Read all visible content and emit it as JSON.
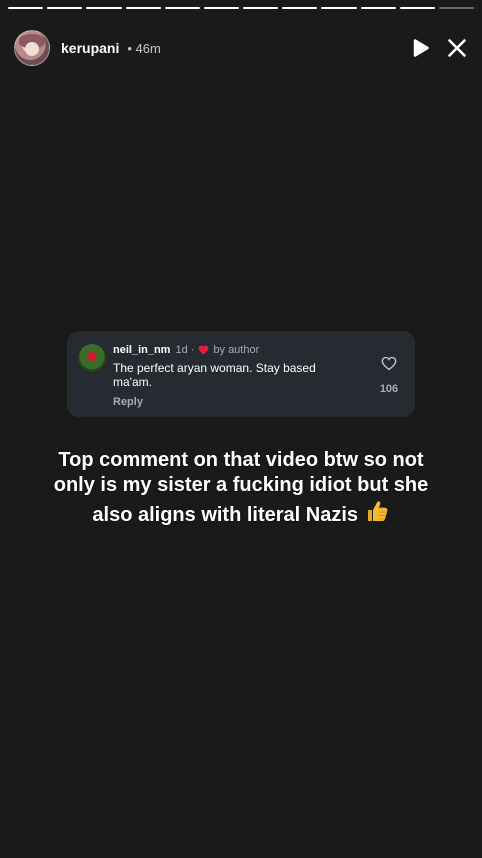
{
  "progress": {
    "segments": [
      1,
      1,
      1,
      1,
      1,
      1,
      1,
      1,
      1,
      1,
      1,
      0
    ]
  },
  "header": {
    "username": "kerupani",
    "time": "• 46m",
    "icons": [
      "play-icon",
      "close-icon"
    ]
  },
  "comment": {
    "username": "neil_in_nm",
    "age": "1d",
    "dot": "·",
    "author_label": "by author",
    "text": "The perfect aryan woman. Stay based ma'am.",
    "reply_label": "Reply",
    "like_count": "106",
    "icons": [
      "heart-icon",
      "like-heart-outline-icon"
    ]
  },
  "caption": {
    "text": "Top comment on that video btw so not only is my sister a fucking idiot but she also aligns with literal Nazis",
    "emoji_icon": "thumbs-up-icon"
  },
  "colors": {
    "background": "#1a1a1a",
    "card": "#262a31",
    "heart": "#e11d38",
    "thumb": "#f5b932"
  }
}
